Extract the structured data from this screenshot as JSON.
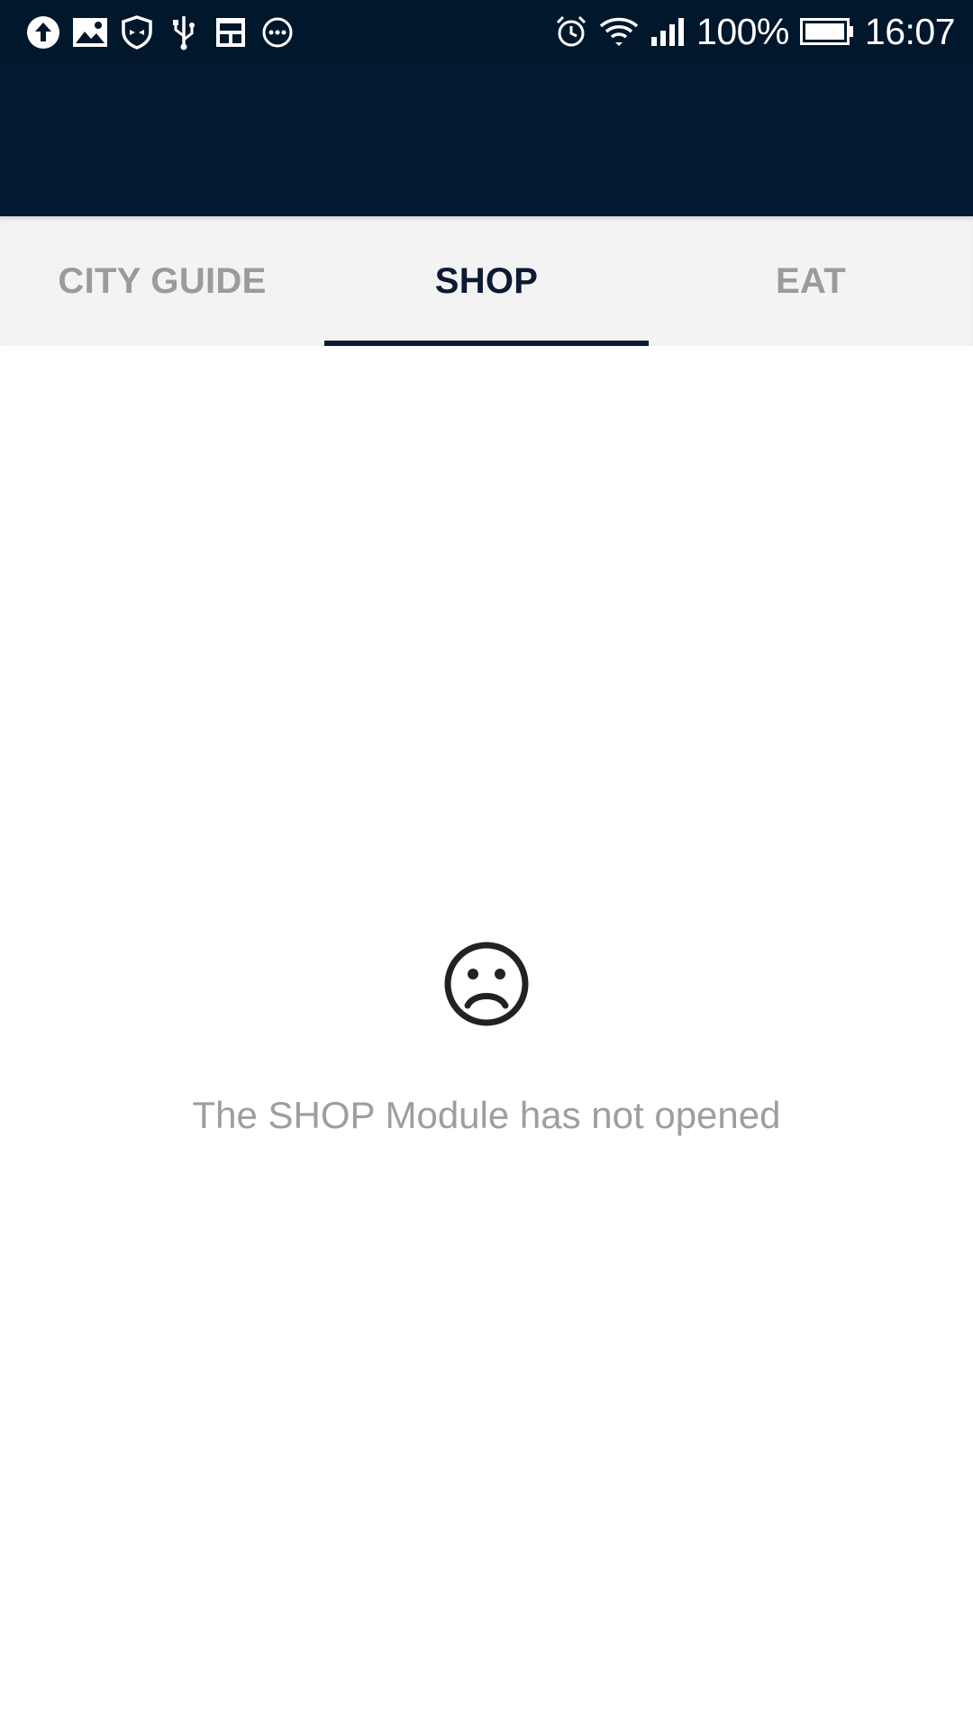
{
  "status_bar": {
    "left_icons": [
      "upload-icon",
      "image-icon",
      "shield-icon",
      "usb-icon",
      "screenshot-icon",
      "more-icon"
    ],
    "right_icons": [
      "alarm-icon",
      "wifi-icon",
      "signal-icon",
      "battery-icon"
    ],
    "battery_percent": "100%",
    "time": "16:07"
  },
  "header": {
    "background_color": "#011a30"
  },
  "tabs": [
    {
      "label": "CITY GUIDE",
      "active": false
    },
    {
      "label": "SHOP",
      "active": true
    },
    {
      "label": "EAT",
      "active": false
    }
  ],
  "empty_state": {
    "icon": "sad-face-icon",
    "message": "The SHOP Module has not opened"
  },
  "colors": {
    "header": "#011a30",
    "tab_bar": "#f3f3f3",
    "active_tab": "#0c1a33",
    "inactive_tab": "#9b9b9b",
    "message_text": "#9e9e9e"
  }
}
